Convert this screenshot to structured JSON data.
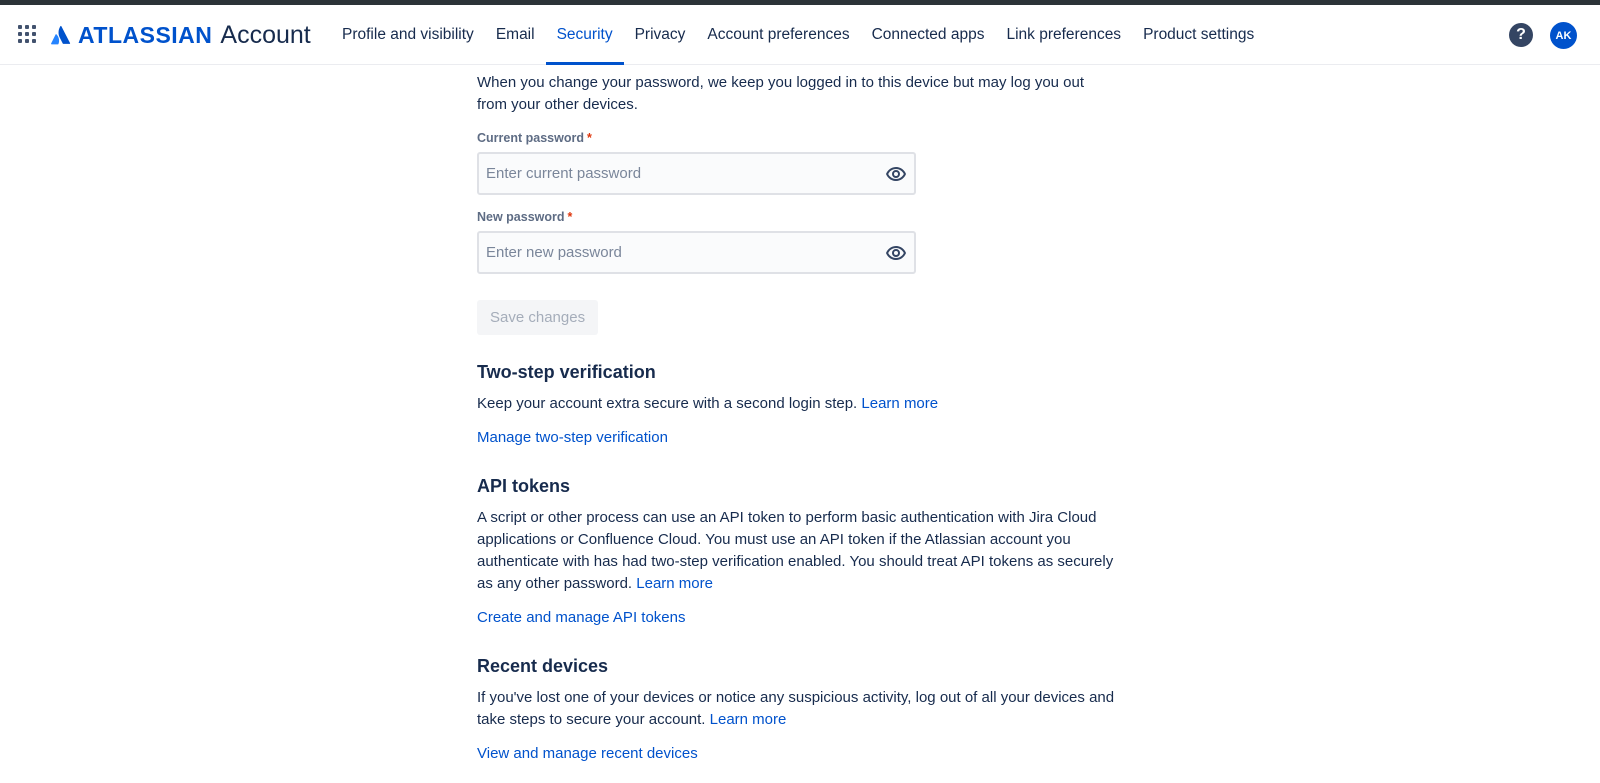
{
  "header": {
    "logo_word": "ATLASSIAN",
    "logo_suffix": "Account",
    "nav": [
      {
        "label": "Profile and visibility"
      },
      {
        "label": "Email"
      },
      {
        "label": "Security"
      },
      {
        "label": "Privacy"
      },
      {
        "label": "Account preferences"
      },
      {
        "label": "Connected apps"
      },
      {
        "label": "Link preferences"
      },
      {
        "label": "Product settings"
      }
    ],
    "active_tab": "Security",
    "help_glyph": "?",
    "avatar_initials": "AK"
  },
  "password": {
    "intro": "When you change your password, we keep you logged in to this device but may log you out from your other devices.",
    "current_label": "Current password",
    "current_placeholder": "Enter current password",
    "new_label": "New password",
    "new_placeholder": "Enter new password",
    "required_mark": "*",
    "save_label": "Save changes"
  },
  "two_step": {
    "title": "Two-step verification",
    "text": "Keep your account extra secure with a second login step.",
    "learn_more": "Learn more",
    "manage_link": "Manage two-step verification"
  },
  "api_tokens": {
    "title": "API tokens",
    "text": "A script or other process can use an API token to perform basic authentication with Jira Cloud applications or Confluence Cloud. You must use an API token if the Atlassian account you authenticate with has had two-step verification enabled. You should treat API tokens as securely as any other password.",
    "learn_more": "Learn more",
    "manage_link": "Create and manage API tokens"
  },
  "recent_devices": {
    "title": "Recent devices",
    "text": "If you've lost one of your devices or notice any suspicious activity, log out of all your devices and take steps to secure your account.",
    "learn_more": "Learn more",
    "manage_link": "View and manage recent devices"
  },
  "icons": {
    "app_switcher": "grid-icon",
    "logo": "atlassian-logo-icon",
    "eye": "eye-icon",
    "help": "help-icon"
  },
  "colors": {
    "brand": "#0052cc",
    "text": "#172b4d",
    "required": "#de350b",
    "disabled_text": "#a5adba"
  }
}
